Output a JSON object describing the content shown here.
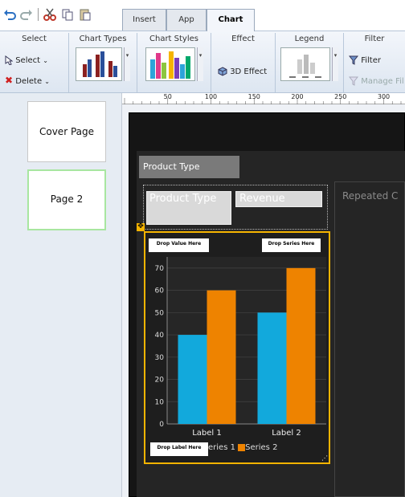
{
  "tabs": [
    {
      "label": "Insert"
    },
    {
      "label": "App"
    },
    {
      "label": "Chart"
    }
  ],
  "groups": {
    "select": {
      "title": "Select",
      "select_label": "Select",
      "delete_label": "Delete"
    },
    "chart_types": {
      "title": "Chart Types"
    },
    "chart_styles": {
      "title": "Chart Styles"
    },
    "effect": {
      "title": "Effect",
      "effect_label": "3D Effect"
    },
    "legend": {
      "title": "Legend"
    },
    "filter": {
      "title": "Filter",
      "filter_label": "Filter",
      "manage_label": "Manage Fil"
    }
  },
  "ruler_ticks": [
    "50",
    "100",
    "150",
    "200",
    "250",
    "300",
    "350"
  ],
  "pages": [
    {
      "label": "Cover Page"
    },
    {
      "label": "Page 2"
    }
  ],
  "canvas": {
    "product_type_header": "Product Type",
    "placeholder_product": "Product Type",
    "placeholder_revenue": "Revenue",
    "repeated_label": "Repeated C",
    "drop_value": "Drop Value Here",
    "drop_series": "Drop Series Here",
    "drop_label": "Drop Label Here",
    "legend_series1": "eries 1",
    "legend_series2": "Series 2"
  },
  "colors": {
    "series1": "#12a9dc",
    "series2": "#ee8300",
    "selection": "#f5b400"
  },
  "chart_data": {
    "type": "bar",
    "categories": [
      "Label 1",
      "Label 2"
    ],
    "series": [
      {
        "name": "Series 1",
        "values": [
          40,
          50
        ]
      },
      {
        "name": "Series 2",
        "values": [
          60,
          70
        ]
      }
    ],
    "yticks": [
      "0",
      "10",
      "20",
      "30",
      "40",
      "50",
      "60",
      "70"
    ],
    "ylim": [
      0,
      75
    ]
  }
}
